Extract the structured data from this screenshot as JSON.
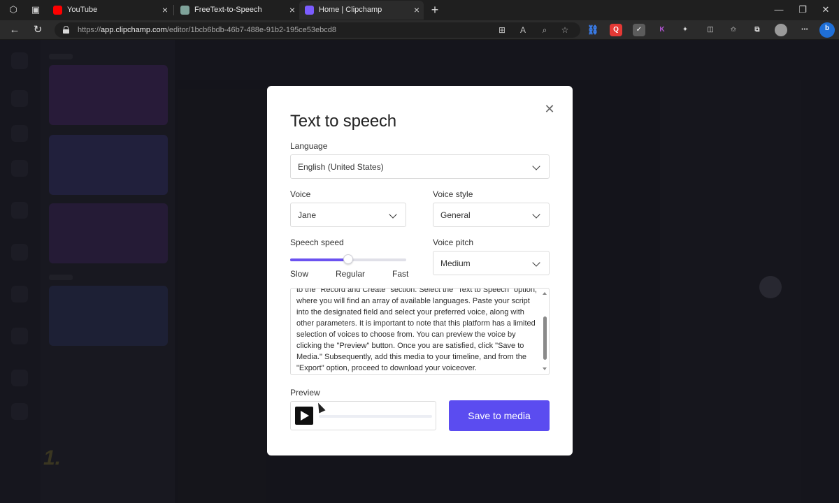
{
  "browser": {
    "tabs": [
      {
        "title": "YouTube",
        "favicon_color": "#ff0000",
        "active": false
      },
      {
        "title": "FreeText-to-Speech",
        "favicon_color": "#7fa39a",
        "active": false
      },
      {
        "title": "Home | Clipchamp",
        "favicon_color": "#7b5cff",
        "active": true
      }
    ],
    "tab_close_glyph": "×",
    "new_tab_glyph": "+",
    "url_scheme": "https://",
    "url_host": "app.clipchamp.com",
    "url_path": "/editor/1bcb6bdb-46b7-488e-91b2-195ce53ebcd8",
    "window_controls": {
      "minimize": "—",
      "restore": "❐",
      "close": "✕"
    },
    "extension_icons": [
      {
        "name": "link-icon",
        "color": "#3b82f6",
        "glyph": "🔗"
      },
      {
        "name": "red-extension-icon",
        "color": "#e53935",
        "glyph": "Q"
      },
      {
        "name": "check-extension-icon",
        "color": "#6b6b6b",
        "glyph": "✓"
      },
      {
        "name": "k-extension-icon",
        "color": "#8e44ad",
        "glyph": "K"
      }
    ]
  },
  "modal": {
    "title": "Text to speech",
    "close_glyph": "✕",
    "language": {
      "label": "Language",
      "value": "English (United States)"
    },
    "voice": {
      "label": "Voice",
      "value": "Jane"
    },
    "voice_style": {
      "label": "Voice style",
      "value": "General"
    },
    "speech_speed": {
      "label": "Speech speed",
      "min_label": "Slow",
      "mid_label": "Regular",
      "max_label": "Fast",
      "value_fraction": 0.5
    },
    "voice_pitch": {
      "label": "Voice pitch",
      "value": "Medium"
    },
    "script_text": "to the \"Record and Create\" section. Select the \"Text to Speech\" option, where you will find an array of available languages. Paste your script into the designated field and select your preferred voice, along with other parameters. It is important to note that this platform has a limited selection of voices to choose from. You can preview the voice by clicking the \"Preview\" button. Once you are satisfied, click \"Save to Media.\" Subsequently, add this media to your timeline, and from the \"Export\" option, proceed to download your voiceover.",
    "preview": {
      "label": "Preview",
      "progress_fraction": 0.0
    },
    "save_button": "Save to media"
  },
  "colors": {
    "accent": "#5b4cf0",
    "slider_fill": "#6b52f0"
  }
}
